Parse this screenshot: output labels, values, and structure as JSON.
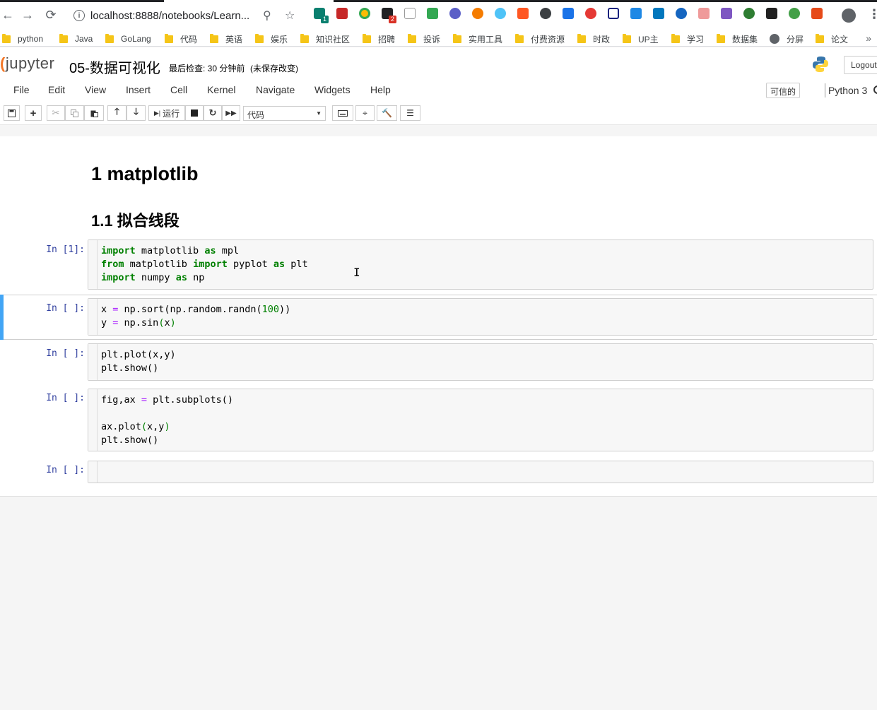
{
  "browser": {
    "url": "localhost:8888/notebooks/Learn...",
    "back_icon": "←",
    "forward_icon": "→",
    "reload_icon": "⟳",
    "zoom_icon": "⚲",
    "star_icon": "☆",
    "menu_icon": "⋮",
    "extension_badges": [
      "1",
      "2"
    ]
  },
  "bookmarks": {
    "items": [
      "python",
      "Java",
      "GoLang",
      "代码",
      "英语",
      "娱乐",
      "知识社区",
      "招聘",
      "投诉",
      "实用工具",
      "付费资源",
      "时政",
      "UP主",
      "学习",
      "数据集",
      "分屏",
      "论文"
    ],
    "more": "»"
  },
  "jupyter": {
    "logo_text": "jupyter",
    "notebook_name": "05-数据可视化",
    "checkpoint": "最后检查: 30 分钟前",
    "autosave": "(未保存改变)",
    "logout": "Logout",
    "menu": [
      "File",
      "Edit",
      "View",
      "Insert",
      "Cell",
      "Kernel",
      "Navigate",
      "Widgets",
      "Help"
    ],
    "trusted": "可信的",
    "kernel": "Python 3",
    "run_label": "运行",
    "cell_type": "代码"
  },
  "notebook": {
    "h1": "1  matplotlib",
    "h2": "1.1  拟合线段",
    "prompts": [
      "In [1]:",
      "In [ ]:",
      "In [ ]:",
      "In [ ]:",
      "In [ ]:"
    ]
  }
}
